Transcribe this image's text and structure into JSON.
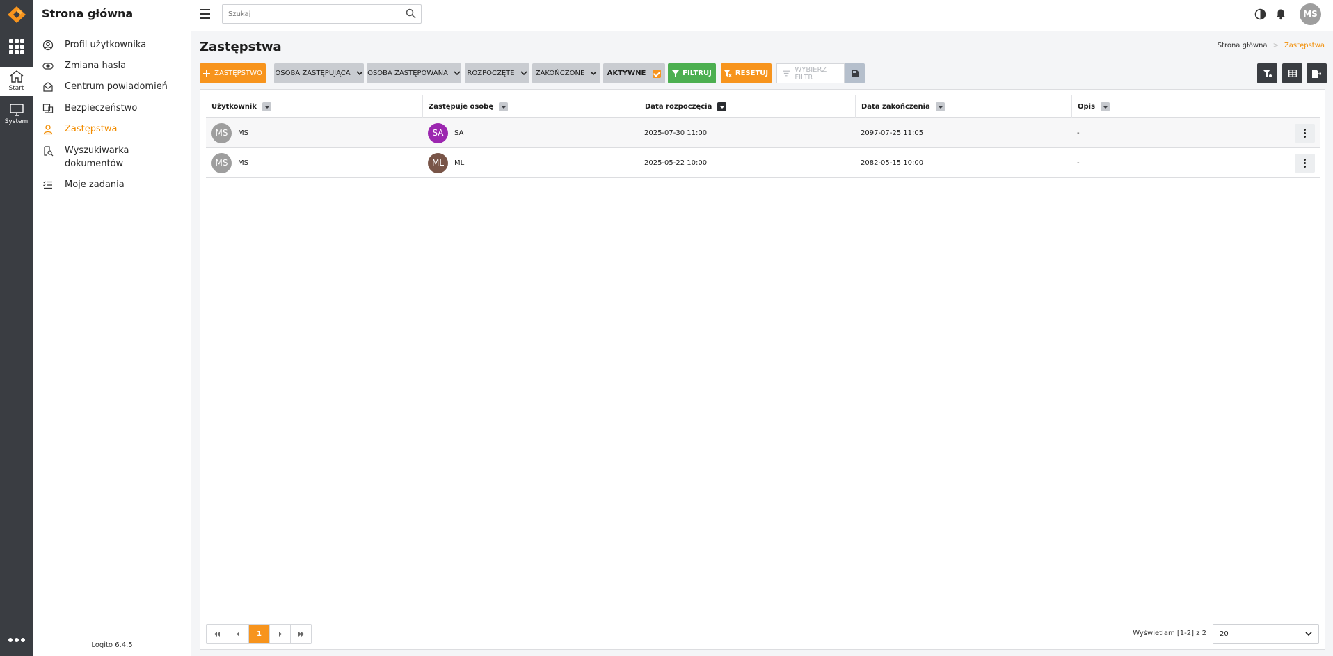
{
  "rail": {
    "items": [
      {
        "label": "Start",
        "icon": "home-icon"
      },
      {
        "label": "System",
        "icon": "monitor-icon"
      }
    ]
  },
  "sidebar": {
    "title": "Strona główna",
    "items": [
      {
        "label": "Profil użytkownika",
        "icon": "user-circle-icon"
      },
      {
        "label": "Zmiana hasła",
        "icon": "eye-icon"
      },
      {
        "label": "Centrum powiadomień",
        "icon": "envelope-icon"
      },
      {
        "label": "Bezpieczeństwo",
        "icon": "devices-icon"
      },
      {
        "label": "Zastępstwa",
        "icon": "user-icon",
        "active": true
      },
      {
        "label": "Wyszukiwarka dokumentów",
        "label_line1": "Wyszukiwarka",
        "label_line2": "dokumentów",
        "icon": "document-search-icon"
      },
      {
        "label": "Moje zadania",
        "icon": "tasks-icon"
      }
    ],
    "version": "Logito 6.4.5"
  },
  "topbar": {
    "search_placeholder": "Szukaj",
    "user_initials": "MS"
  },
  "page": {
    "title": "Zastępstwa",
    "breadcrumb": [
      "Strona główna",
      "Zastępstwa"
    ]
  },
  "toolbar": {
    "add_label": "ZASTĘPSTWO",
    "filters": [
      "OSOBA ZASTĘPUJĄCA",
      "OSOBA ZASTĘPOWANA",
      "ROZPOCZĘTE",
      "ZAKOŃCZONE"
    ],
    "active_label": "AKTYWNE",
    "active_checked": true,
    "filter_label": "FILTRUJ",
    "reset_label": "RESETUJ",
    "choose_filter_placeholder": "WYBIERZ FILTR"
  },
  "table": {
    "columns": [
      "Użytkownik",
      "Zastępuje osobę",
      "Data rozpoczęcia",
      "Data zakończenia",
      "Opis"
    ],
    "sorted_column": "Data rozpoczęcia",
    "rows": [
      {
        "user": "MS",
        "user_avatar": "MS",
        "user_color": "#9e9e9e",
        "replaces": "SA",
        "replaces_avatar": "SA",
        "replaces_color": "#9c27b0",
        "start": "2025-07-30 11:00",
        "end": "2097-07-25 11:05",
        "desc": "-"
      },
      {
        "user": "MS",
        "user_avatar": "MS",
        "user_color": "#9e9e9e",
        "replaces": "ML",
        "replaces_avatar": "ML",
        "replaces_color": "#795548",
        "start": "2025-05-22 10:00",
        "end": "2082-05-15 10:00",
        "desc": "-"
      }
    ]
  },
  "footer": {
    "current_page": "1",
    "showing": "Wyświetlam [1-2] z 2",
    "page_size": "20"
  },
  "colors": {
    "accent": "#f7941d",
    "green": "#4caf50",
    "rail": "#3a3d42"
  }
}
